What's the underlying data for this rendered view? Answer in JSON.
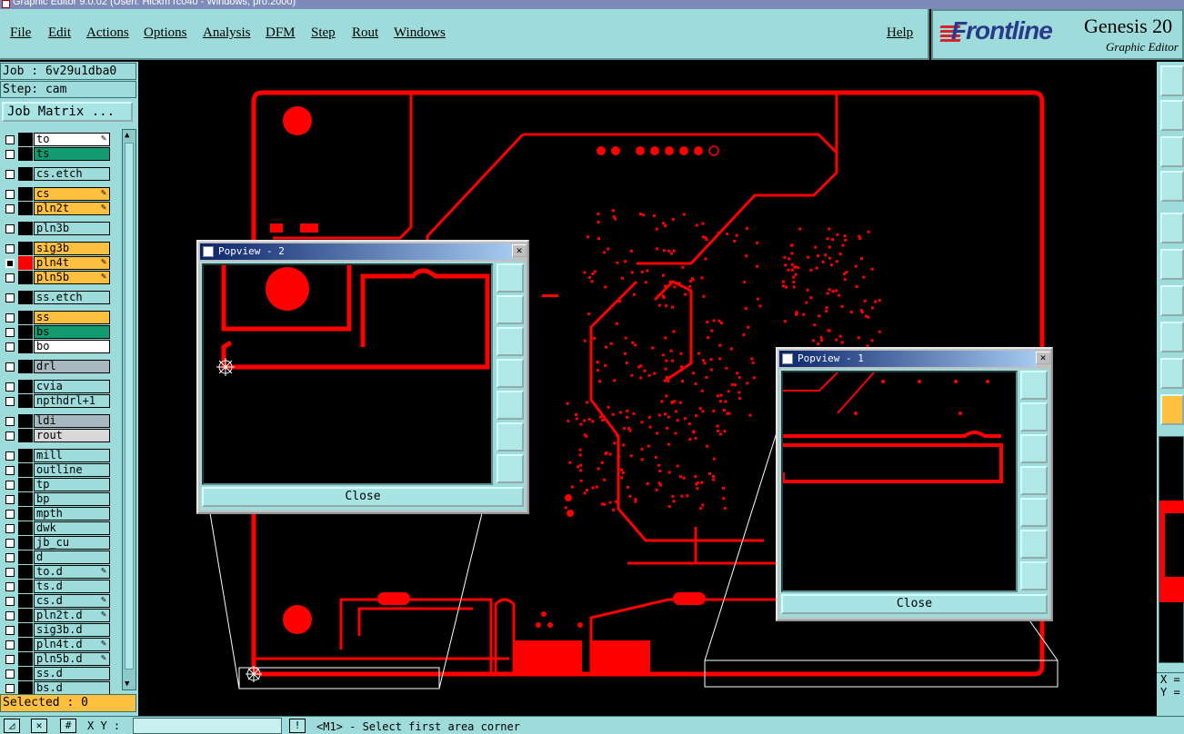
{
  "window": {
    "title": "Graphic Editor 9.0.02 (Usen: Hickm rc040 - Windows, pro.2000)"
  },
  "menu": {
    "items": [
      "File",
      "Edit",
      "Actions",
      "Options",
      "Analysis",
      "DFM",
      "Step",
      "Rout",
      "Windows"
    ],
    "help": "Help"
  },
  "brand": {
    "name": "Frontline",
    "product": "Genesis 20",
    "subtitle": "Graphic Editor"
  },
  "job": {
    "job_label": "Job : 6v29u1dba0",
    "step_label": "Step: cam",
    "matrix_button": "Job Matrix ..."
  },
  "layers": [
    {
      "name": "to",
      "color": "#ffffff",
      "edit": true
    },
    {
      "name": "ts",
      "color": "#139a6e",
      "edit": false
    },
    {
      "name": "cs.etch",
      "color": "#9edcdc",
      "edit": false
    },
    {
      "name": "cs",
      "color": "#ffc040",
      "edit": true
    },
    {
      "name": "pln2t",
      "color": "#ffc040",
      "edit": true
    },
    {
      "name": "pln3b",
      "color": "#9edcdc",
      "edit": false
    },
    {
      "name": "sig3b",
      "color": "#ffc040",
      "edit": false
    },
    {
      "name": "pln4t",
      "color": "#ffc040",
      "edit": true,
      "active": true
    },
    {
      "name": "pln5b",
      "color": "#ffc040",
      "edit": true
    },
    {
      "name": "ss.etch",
      "color": "#9edcdc",
      "edit": false
    },
    {
      "name": "ss",
      "color": "#ffc040",
      "edit": false
    },
    {
      "name": "bs",
      "color": "#139a6e",
      "edit": false
    },
    {
      "name": "bo",
      "color": "#ffffff",
      "edit": false
    },
    {
      "name": "drl",
      "color": "#a8b8c0",
      "edit": false
    },
    {
      "name": "cvia",
      "color": "#9edcdc",
      "edit": false
    },
    {
      "name": "npthdrl+1",
      "color": "#9edcdc",
      "edit": false
    },
    {
      "name": "ldi",
      "color": "#a8b8c0",
      "edit": false
    },
    {
      "name": "rout",
      "color": "#d8d8d8",
      "edit": false
    },
    {
      "name": "mill",
      "color": "#9edcdc",
      "edit": false
    },
    {
      "name": "outline",
      "color": "#9edcdc",
      "edit": false
    },
    {
      "name": "tp",
      "color": "#9edcdc",
      "edit": false
    },
    {
      "name": "bp",
      "color": "#9edcdc",
      "edit": false
    },
    {
      "name": "mpth",
      "color": "#9edcdc",
      "edit": false
    },
    {
      "name": "dwk",
      "color": "#9edcdc",
      "edit": false
    },
    {
      "name": "jb_cu",
      "color": "#9edcdc",
      "edit": false
    },
    {
      "name": "d",
      "color": "#9edcdc",
      "edit": false
    },
    {
      "name": "to.d",
      "color": "#9edcdc",
      "edit": true
    },
    {
      "name": "ts.d",
      "color": "#9edcdc",
      "edit": false
    },
    {
      "name": "cs.d",
      "color": "#9edcdc",
      "edit": true
    },
    {
      "name": "pln2t.d",
      "color": "#9edcdc",
      "edit": true
    },
    {
      "name": "sig3b.d",
      "color": "#9edcdc",
      "edit": false
    },
    {
      "name": "pln4t.d",
      "color": "#9edcdc",
      "edit": true
    },
    {
      "name": "pln5b.d",
      "color": "#9edcdc",
      "edit": true
    },
    {
      "name": "ss.d",
      "color": "#9edcdc",
      "edit": false
    },
    {
      "name": "bs.d",
      "color": "#9edcdc",
      "edit": false
    }
  ],
  "status": {
    "selected": "Selected : 0",
    "xy_label": "X Y :",
    "message": "<M1> - Select first area corner",
    "coord_x": "X =",
    "coord_y": "Y ="
  },
  "popview1": {
    "title": "Popview - 1",
    "close": "Close"
  },
  "popview2": {
    "title": "Popview - 2",
    "close": "Close"
  },
  "colors": {
    "trace": "#ff0000",
    "panel": "#9edcdc",
    "accent": "#ffc040"
  }
}
